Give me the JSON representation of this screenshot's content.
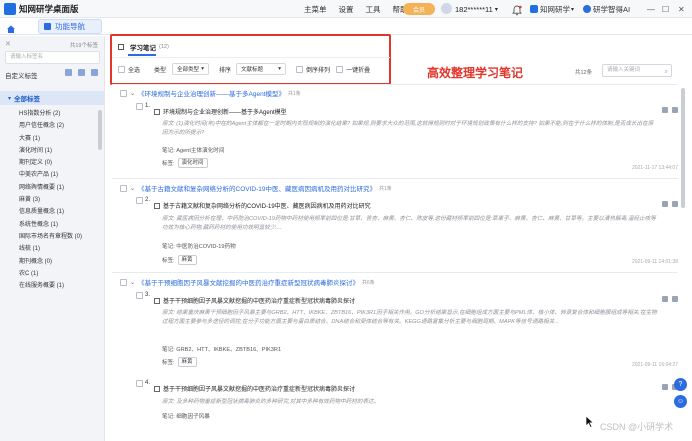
{
  "app": {
    "title": "知网研学桌面版"
  },
  "topmenu": {
    "items": [
      "主菜单",
      "设置",
      "工具",
      "帮助"
    ],
    "ad_label": "会员"
  },
  "user": {
    "phone": "182******11"
  },
  "top_links": {
    "app1": "知网研学",
    "app2": "研学智得AI"
  },
  "nav": {
    "tab_label": "功能导航"
  },
  "sidebar": {
    "count": "共19个标签",
    "search_placeholder": "请输入标签名",
    "custom_label": "自定义标签",
    "all_label": "全部标签",
    "items": [
      "HS指数分析 (2)",
      "用户信任概念 (2)",
      "大赛 (1)",
      "演化时间 (1)",
      "期刊定义 (0)",
      "中美农产品 (1)",
      "网络舆情概要 (1)",
      "麻黄 (3)",
      "信息质量概念 (1)",
      "系统性概念 (1)",
      "国际市场名有章程数 (0)",
      "线梳 (1)",
      "期刊概念 (0)",
      "农C (1)",
      "在线服务概要 (1)"
    ]
  },
  "header": {
    "title": "学习笔记",
    "count": "(12)"
  },
  "toolbar": {
    "select_all": "全选",
    "type_label": "类型",
    "type_value": "全部类型",
    "sort_label": "排序",
    "sort_value": "文献标题",
    "reverse_label": "倒序排列",
    "collapse_label": "一键折叠"
  },
  "headline": "高效整理学习笔记",
  "total": "共12条",
  "search_placeholder": "请输入关键词",
  "groups": [
    {
      "title": "《环境规制与企业治理创新——基于多Agent模型》",
      "count": "共1条",
      "cards": [
        {
          "no": "1.",
          "title": "环境规制与企业治理创新——基于多Agent模型",
          "body": "原文: (1)演化时间(年)中在的Agent主体都在一定时期内实现规制的演化结果? 如果规,则要求大众的范围,这就得规则时对于环境规划政策有什么样的支持? 如果不能,则在于什么样的体制,是否成长出在原因为示的所提示?",
          "note": "笔记: Agent主体演化时间",
          "tag_label": "标签:",
          "tag": "演化时间",
          "time": "2021-11-17 13:44:07"
        }
      ]
    },
    {
      "title": "《基于古籍文献和复杂网络分析的COVID-19中医、藏医病因病机及用药对比研究》",
      "count": "共1条",
      "cards": [
        {
          "no": "2.",
          "title": "基于古籍文献和复杂网络分析的COVID-19中医、藏医病因病机及用药对比研究",
          "body": "原文: 藏医病因分析在理、中药防治COVID-19药物中药材使用频率前四位是:甘草、苦杏、麻黄、杏仁、陈皮等,这份藏材频率前四位是:草果子、麻黄、杏仁、麻黄、甘草等。主要以清热解毒,温经止咳等功效为核心药物,藏药药材的使用功效明显较少,...",
          "note": "笔记: 中医防治COVID-19药物",
          "tag_label": "标签:",
          "tag": "麻黄",
          "time": "2021-09-11 14:01:38"
        }
      ]
    },
    {
      "title": "《基于干预细胞因子风暴文献挖掘的中医药治疗重症新型冠状病毒肺炎探讨》",
      "count": "共6条",
      "cards": [
        {
          "no": "3.",
          "title": "基于干预细胞因子风暴文献挖掘的中医药治疗重症新型冠状病毒肺炎探讨",
          "body": "原文: 结果重庆麻黄干预细胞因子风暴主要与GRB2、HTT、IKBKE、ZBTB16、PIK3R1因子相关作用。GO分析结果显示,在细胞组成方面主要与PML体、核小体、转录复合体和细胞膜组成等相关,在生物过程方面主要参与多途径的调控,在分子功能方面主要与蛋白质结合、DNA结合和受体结合等有关。KEGG通路富集分析主要与细胞周期、MAPK等信号通路相关...",
          "note": "笔记: GRB2、HTT、IKBKE、ZBTB16、PIK3R1",
          "tag_label": "标签:",
          "tag": "麻黄",
          "time": "2021-09-11 16:04:27"
        },
        {
          "no": "4.",
          "title": "基于干预细胞因子风暴文献挖掘的中医药治疗重症新型冠状病毒肺炎探讨",
          "body": "原文: 及多种药物重症新型冠状病毒肺炎的多种研究,对其中多种有效药物中药材的表达。",
          "note": "笔记: 细胞因子风暴",
          "tag_label": "",
          "tag": "",
          "time": ""
        }
      ]
    }
  ],
  "watermark": "CSDN @小研学术"
}
